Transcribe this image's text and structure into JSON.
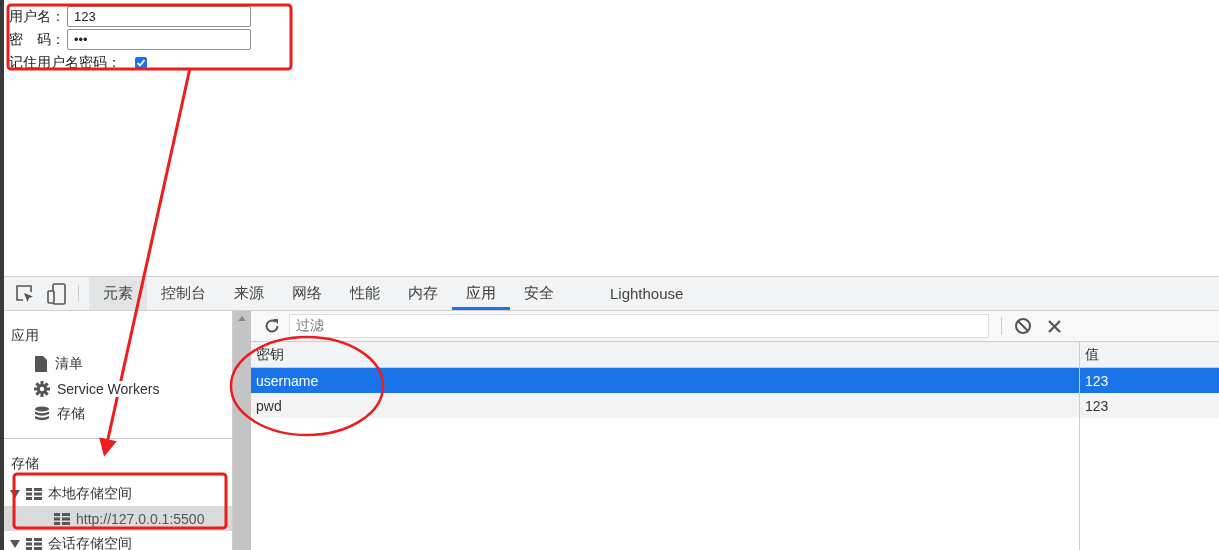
{
  "form": {
    "fields": [
      {
        "label": "用户名：",
        "value": "123"
      },
      {
        "label": "密　码：",
        "value": "•••"
      }
    ],
    "remember": {
      "label": "记住用户名密码：",
      "checked": true
    }
  },
  "devtools": {
    "tabs": [
      {
        "label": "元素",
        "selected": false,
        "hovered": true
      },
      {
        "label": "控制台",
        "selected": false,
        "hovered": false
      },
      {
        "label": "来源",
        "selected": false,
        "hovered": false
      },
      {
        "label": "网络",
        "selected": false,
        "hovered": false
      },
      {
        "label": "性能",
        "selected": false,
        "hovered": false
      },
      {
        "label": "内存",
        "selected": false,
        "hovered": false
      },
      {
        "label": "应用",
        "selected": true,
        "hovered": false
      },
      {
        "label": "安全",
        "selected": false,
        "hovered": false
      },
      {
        "label": "Lighthouse",
        "selected": false,
        "hovered": false
      }
    ],
    "sidebar": {
      "application": {
        "heading": "应用",
        "items": [
          {
            "label": "清单",
            "kind": "file"
          },
          {
            "label": "Service Workers",
            "kind": "gear"
          },
          {
            "label": "存储",
            "kind": "database"
          }
        ]
      },
      "storage": {
        "heading": "存储",
        "tree": [
          {
            "label": "本地存储空间",
            "expanded": true,
            "selected": false,
            "children": [
              {
                "label": "http://127.0.0.1:5500",
                "selected": true
              }
            ]
          },
          {
            "label": "会话存储空间",
            "expanded": true,
            "selected": false
          }
        ]
      }
    },
    "filter": {
      "placeholder": "过滤"
    },
    "table": {
      "columns": [
        "密钥",
        "值"
      ],
      "rows": [
        {
          "cells": [
            "username",
            "123"
          ],
          "selected": true
        },
        {
          "cells": [
            "pwd",
            "123"
          ],
          "selected": false
        }
      ]
    }
  }
}
